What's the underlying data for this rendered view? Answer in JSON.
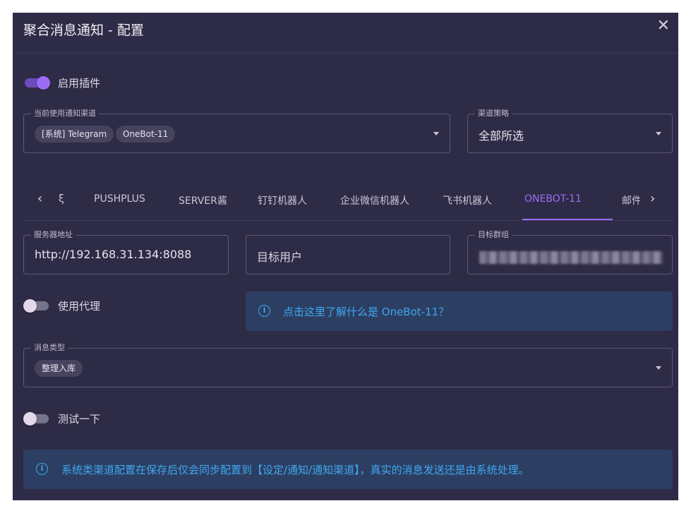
{
  "dialog": {
    "title": "聚合消息通知 - 配置",
    "close_icon": "✕"
  },
  "enable_plugin": {
    "label": "启用插件",
    "checked": true
  },
  "channels": {
    "legend": "当前使用通知渠道",
    "chips": [
      "[系统] Telegram",
      "OneBot-11"
    ]
  },
  "strategy": {
    "legend": "渠道策略",
    "value": "全部所选"
  },
  "tabs": {
    "prev_icon": "‹",
    "next_icon": "›",
    "items": [
      "ξ",
      "PUSHPLUS",
      "SERVER酱",
      "钉钉机器人",
      "企业微信机器人",
      "飞书机器人",
      "ONEBOT-11",
      "邮件"
    ],
    "active": "ONEBOT-11"
  },
  "server_address": {
    "legend": "服务器地址",
    "value": "http://192.168.31.134:8088"
  },
  "target_user": {
    "placeholder": "目标用户"
  },
  "target_group": {
    "legend": "目标群组"
  },
  "use_proxy": {
    "label": "使用代理",
    "checked": false
  },
  "onebot_info": {
    "icon": "info-icon",
    "text": "点击这里了解什么是 OneBot-11？"
  },
  "message_type": {
    "legend": "消息类型",
    "chips": [
      "整理入库"
    ]
  },
  "test": {
    "label": "测试一下",
    "checked": false
  },
  "system_info": {
    "icon": "info-icon",
    "text": "系统类渠道配置在保存后仅会同步配置到【设定/通知/通知渠道】，真实的消息发送还是由系统处理。"
  },
  "colors": {
    "background": "#2e2b46",
    "accent": "#9b6cf5",
    "info": "#3fa7ef"
  }
}
